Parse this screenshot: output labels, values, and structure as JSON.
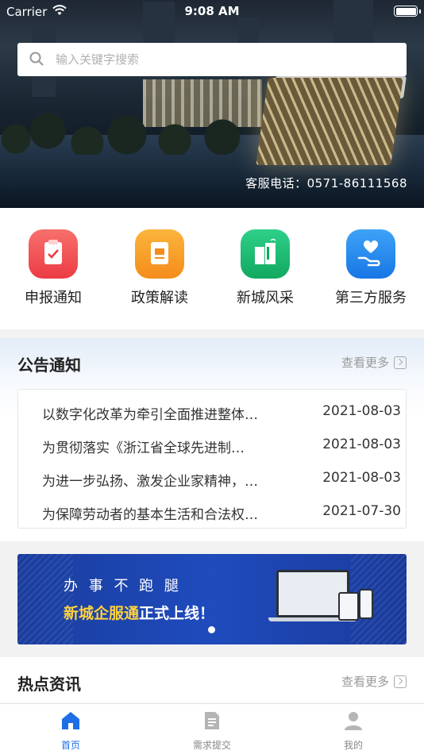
{
  "status_bar": {
    "carrier": "Carrier",
    "time": "9:08 AM"
  },
  "search": {
    "placeholder": "输入关键字搜索"
  },
  "hero": {
    "hotline": "客服电话：0571-86111568"
  },
  "quick_entries": [
    {
      "label": "申报通知",
      "icon": "clipboard-check-icon",
      "color": "#f0504f"
    },
    {
      "label": "政策解读",
      "icon": "document-icon",
      "color": "#f9a02c"
    },
    {
      "label": "新城风采",
      "icon": "buildings-icon",
      "color": "#1fbf73"
    },
    {
      "label": "第三方服务",
      "icon": "hand-heart-icon",
      "color": "#2b8ef0"
    }
  ],
  "notices": {
    "title": "公告通知",
    "more": "查看更多",
    "items": [
      {
        "title": "以数字化改革为牵引全面推进整体…",
        "date": "2021-08-03"
      },
      {
        "title": " 为贯彻落实《浙江省全球先进制…",
        "date": "2021-08-03"
      },
      {
        "title": "为进一步弘扬、激发企业家精神，…",
        "date": "2021-08-03"
      },
      {
        "title": "为保障劳动者的基本生活和合法权…",
        "date": "2021-07-30"
      }
    ]
  },
  "banner": {
    "line1": "办 事 不 跑 腿",
    "line2_highlight": "新城企服通",
    "line2_rest": "正式上线！"
  },
  "hot_news": {
    "title": "热点资讯",
    "more": "查看更多"
  },
  "tabbar": [
    {
      "label": "首页",
      "icon": "home-icon",
      "active": true
    },
    {
      "label": "需求提交",
      "icon": "document-icon",
      "active": false
    },
    {
      "label": "我的",
      "icon": "user-icon",
      "active": false
    }
  ],
  "colors": {
    "accent": "#1e6fe6",
    "banner": "#1f4bbd",
    "highlight": "#ffd23c"
  }
}
